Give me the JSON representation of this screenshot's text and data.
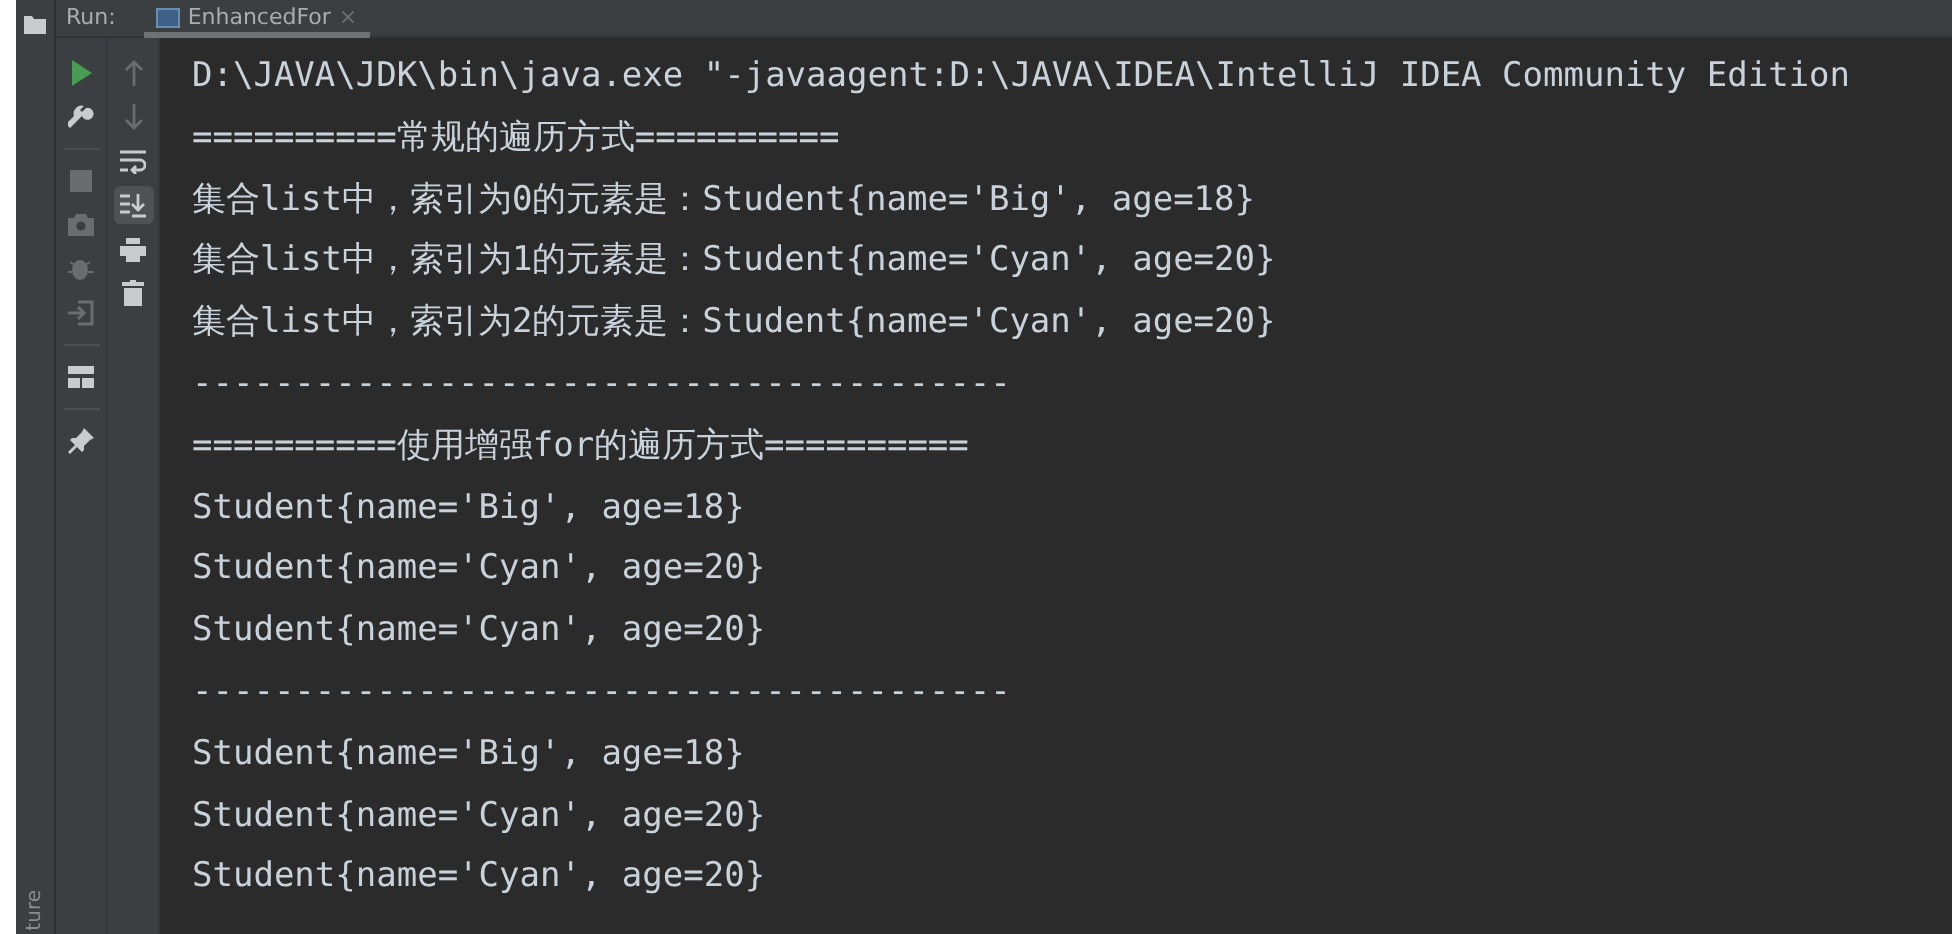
{
  "side_strip": {
    "label": "ture"
  },
  "run_panel": {
    "title": "Run:",
    "tabs": [
      {
        "label": "EnhancedFor",
        "close": "×",
        "selected": true
      }
    ]
  },
  "run_toolbar": [
    {
      "disabled": false
    },
    {
      "disabled": false
    },
    {
      "disabled": true
    },
    {
      "disabled": true
    },
    {
      "disabled": true
    },
    {
      "disabled": true
    },
    {
      "disabled": false
    },
    {
      "disabled": false
    }
  ],
  "console_toolbar": [
    {
      "disabled": true,
      "toggled": false
    },
    {
      "disabled": true,
      "toggled": false
    },
    {
      "disabled": false,
      "toggled": false
    },
    {
      "disabled": false,
      "toggled": true
    },
    {
      "disabled": false,
      "toggled": false
    },
    {
      "disabled": false,
      "toggled": false
    }
  ],
  "console_lines": [
    "D:\\JAVA\\JDK\\bin\\java.exe \"-javaagent:D:\\JAVA\\IDEA\\IntelliJ IDEA Community Edition",
    "==========常规的遍历方式==========",
    "集合list中，索引为0的元素是：Student{name='Big', age=18}",
    "集合list中，索引为1的元素是：Student{name='Cyan', age=20}",
    "集合list中，索引为2的元素是：Student{name='Cyan', age=20}",
    "----------------------------------------",
    "==========使用增强for的遍历方式==========",
    "Student{name='Big', age=18}",
    "Student{name='Cyan', age=20}",
    "Student{name='Cyan', age=20}",
    "----------------------------------------",
    "Student{name='Big', age=18}",
    "Student{name='Cyan', age=20}",
    "Student{name='Cyan', age=20}"
  ]
}
